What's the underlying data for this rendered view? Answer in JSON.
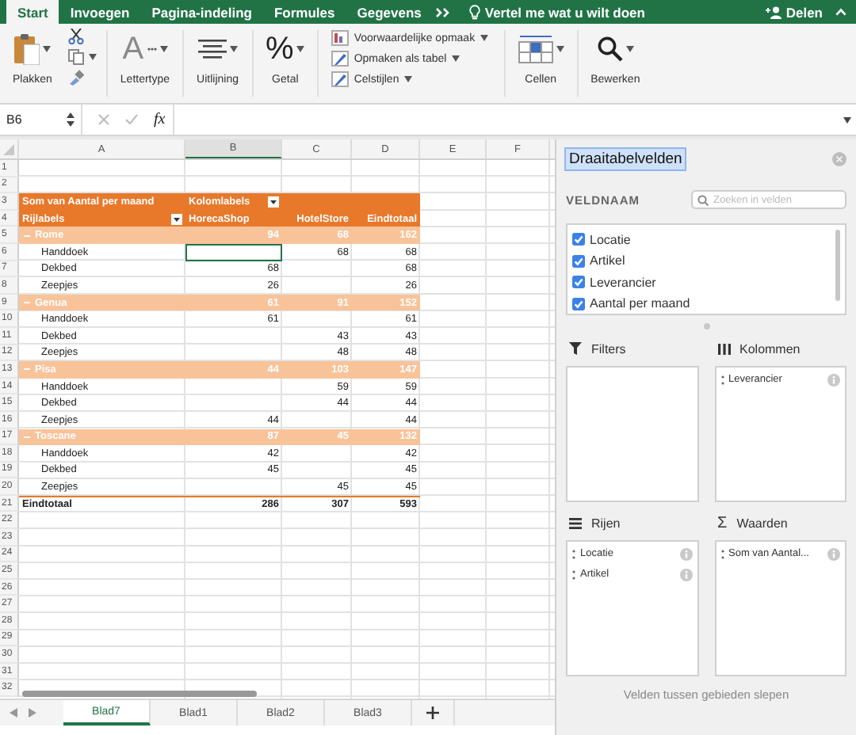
{
  "ribbon_tabs": [
    {
      "label": "Start",
      "selected": true
    },
    {
      "label": "Invoegen",
      "selected": false
    },
    {
      "label": "Pagina-indeling",
      "selected": false
    },
    {
      "label": "Formules",
      "selected": false
    },
    {
      "label": "Gegevens",
      "selected": false
    }
  ],
  "tell_me": "Vertel me wat u wilt doen",
  "share": "Delen",
  "ribbon": {
    "paste": "Plakken",
    "font": {
      "glyph": "A",
      "label": "Lettertype"
    },
    "alignment": "Uitlijning",
    "number": {
      "glyph": "%",
      "label": "Getal"
    },
    "styles": [
      "Voorwaardelijke opmaak",
      "Opmaken als tabel",
      "Celstijlen"
    ],
    "cells": "Cellen",
    "editing": "Bewerken"
  },
  "formula_bar": {
    "name_box": "B6",
    "fx": "fx"
  },
  "column_headers": [
    {
      "label": "A",
      "selected": false
    },
    {
      "label": "B",
      "selected": true
    },
    {
      "label": "C",
      "selected": false
    },
    {
      "label": "D",
      "selected": false
    },
    {
      "label": "E",
      "selected": false
    },
    {
      "label": "F",
      "selected": false
    }
  ],
  "row_headers": [
    "1",
    "2",
    "3",
    "4",
    "5",
    "6",
    "7",
    "8",
    "9",
    "10",
    "11",
    "12",
    "13",
    "14",
    "15",
    "16",
    "17",
    "18",
    "19",
    "20",
    "21",
    "22",
    "23",
    "24",
    "25",
    "26",
    "27",
    "28",
    "29",
    "30",
    "31",
    "32"
  ],
  "pivot": {
    "value_label": "Som van Aantal per maand",
    "column_labels": "Kolomlabels",
    "row_labels": "Rijlabels",
    "columns": [
      "HorecaShop",
      "HotelStore",
      "Eindtotaal"
    ],
    "groups": [
      {
        "name": "Rome",
        "expanded": true,
        "values": [
          "94",
          "68",
          "162"
        ],
        "items": [
          {
            "name": "Handdoek",
            "cells": [
              {
                "selected": true
              },
              {
                "value": "68",
                "selected": false
              },
              {
                "value": "68",
                "selected": false
              }
            ]
          },
          {
            "name": "Dekbed",
            "cells": [
              {
                "value": "68",
                "selected": false
              },
              {
                "selected": false
              },
              {
                "value": "68",
                "selected": false
              }
            ]
          },
          {
            "name": "Zeepjes",
            "cells": [
              {
                "value": "26",
                "selected": false
              },
              {
                "selected": false
              },
              {
                "value": "26",
                "selected": false
              }
            ]
          }
        ]
      },
      {
        "name": "Genua",
        "expanded": true,
        "values": [
          "61",
          "91",
          "152"
        ],
        "items": [
          {
            "name": "Handdoek",
            "cells": [
              {
                "value": "61",
                "selected": false
              },
              {
                "selected": false
              },
              {
                "value": "61",
                "selected": false
              }
            ]
          },
          {
            "name": "Dekbed",
            "cells": [
              {
                "selected": false
              },
              {
                "value": "43",
                "selected": false
              },
              {
                "value": "43",
                "selected": false
              }
            ]
          },
          {
            "name": "Zeepjes",
            "cells": [
              {
                "selected": false
              },
              {
                "value": "48",
                "selected": false
              },
              {
                "value": "48",
                "selected": false
              }
            ]
          }
        ]
      },
      {
        "name": "Pisa",
        "expanded": true,
        "values": [
          "44",
          "103",
          "147"
        ],
        "items": [
          {
            "name": "Handdoek",
            "cells": [
              {
                "selected": false
              },
              {
                "value": "59",
                "selected": false
              },
              {
                "value": "59",
                "selected": false
              }
            ]
          },
          {
            "name": "Dekbed",
            "cells": [
              {
                "selected": false
              },
              {
                "value": "44",
                "selected": false
              },
              {
                "value": "44",
                "selected": false
              }
            ]
          },
          {
            "name": "Zeepjes",
            "cells": [
              {
                "value": "44",
                "selected": false
              },
              {
                "selected": false
              },
              {
                "value": "44",
                "selected": false
              }
            ]
          }
        ]
      },
      {
        "name": "Toscane",
        "expanded": true,
        "values": [
          "87",
          "45",
          "132"
        ],
        "items": [
          {
            "name": "Handdoek",
            "cells": [
              {
                "value": "42",
                "selected": false
              },
              {
                "selected": false
              },
              {
                "value": "42",
                "selected": false
              }
            ]
          },
          {
            "name": "Dekbed",
            "cells": [
              {
                "value": "45",
                "selected": false
              },
              {
                "selected": false
              },
              {
                "value": "45",
                "selected": false
              }
            ]
          },
          {
            "name": "Zeepjes",
            "cells": [
              {
                "selected": false
              },
              {
                "value": "45",
                "selected": false
              },
              {
                "value": "45",
                "selected": false
              }
            ]
          }
        ]
      }
    ],
    "total": {
      "label": "Eindtotaal",
      "values": [
        "286",
        "307",
        "593"
      ]
    }
  },
  "sheet_tabs": [
    {
      "label": "Blad7",
      "selected": true
    },
    {
      "label": "Blad1",
      "selected": false
    },
    {
      "label": "Blad2",
      "selected": false
    },
    {
      "label": "Blad3",
      "selected": false
    }
  ],
  "pane": {
    "title": {
      "text": "Draaitabelvelden",
      "selected": true
    },
    "field_name_label": "VELDNAAM",
    "search": {
      "placeholder": "Zoeken in velden"
    },
    "fields": [
      {
        "label": "Locatie",
        "checked": true
      },
      {
        "label": "Artikel",
        "checked": true
      },
      {
        "label": "Leverancier",
        "checked": true
      },
      {
        "label": "Aantal per maand",
        "checked": true
      }
    ],
    "areas": [
      {
        "kind": "filters",
        "title": "Filters"
      },
      {
        "kind": "columns",
        "title": "Kolommen",
        "fields": [
          "Leverancier"
        ]
      },
      {
        "kind": "rows",
        "title": "Rijen",
        "fields": [
          "Locatie",
          "Artikel"
        ]
      },
      {
        "kind": "values",
        "title": "Waarden",
        "glyph": "Σ",
        "fields": [
          "Som van Aantal..."
        ]
      }
    ],
    "hint": "Velden tussen gebieden slepen"
  }
}
